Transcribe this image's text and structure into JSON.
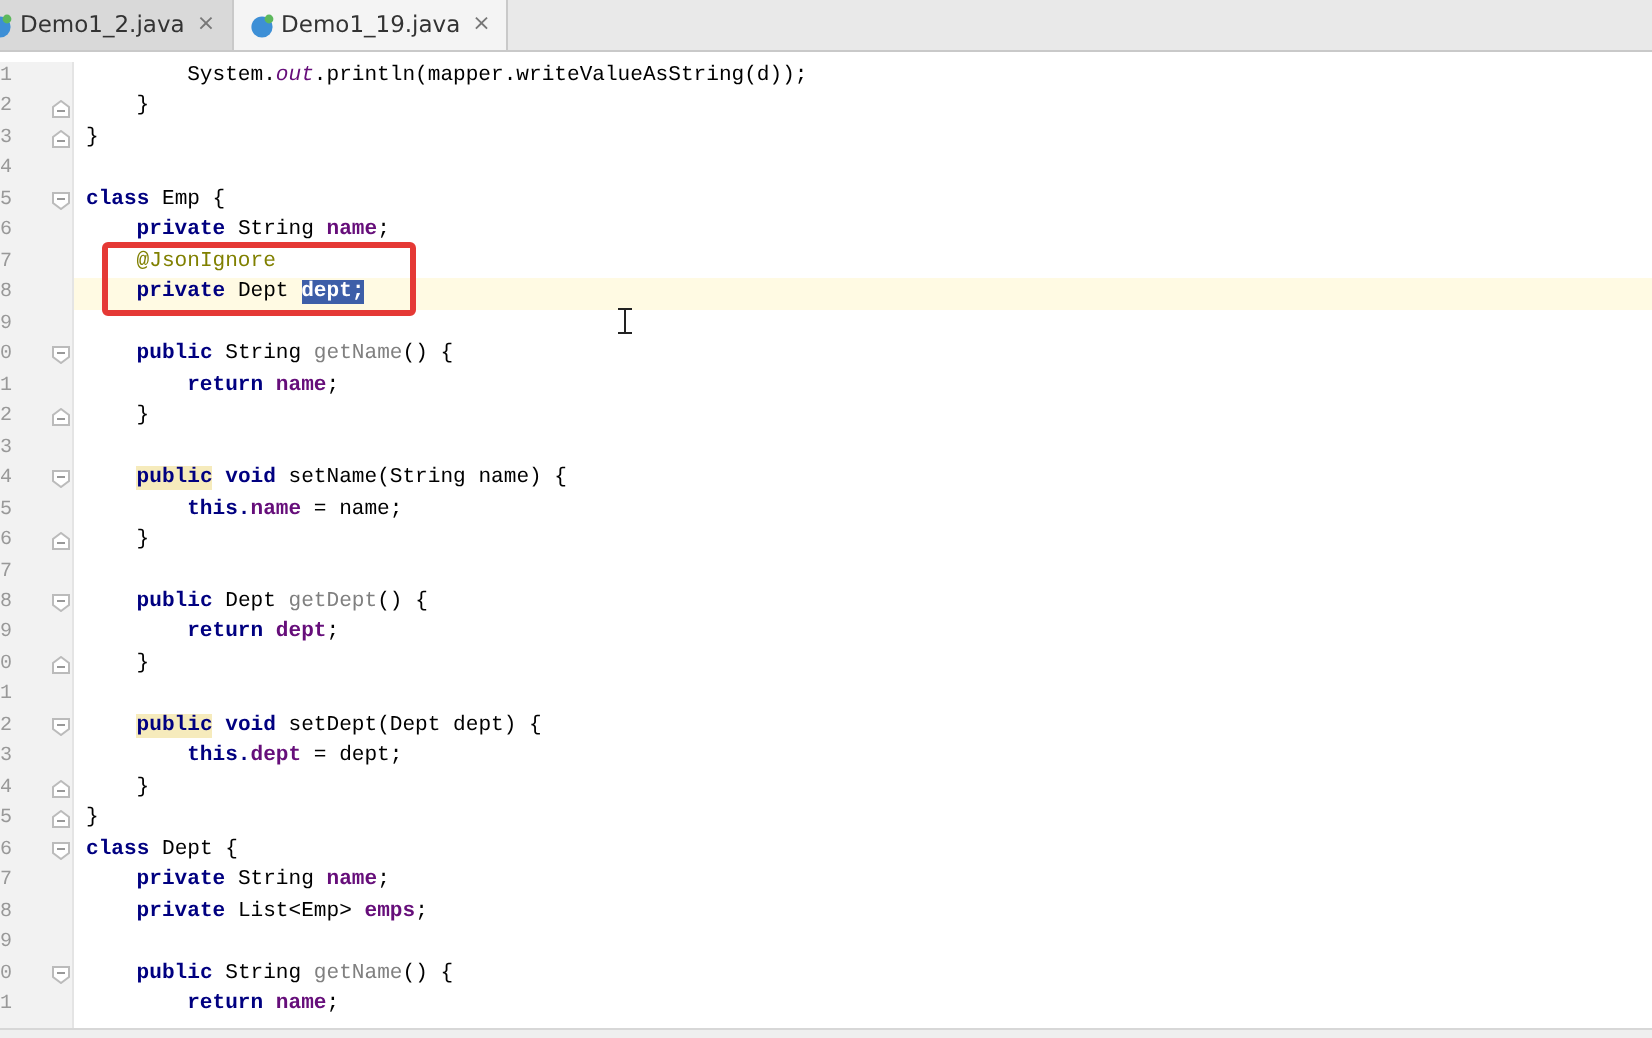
{
  "tabs": [
    {
      "label": "Demo1_2.java",
      "close": "×",
      "selected": false
    },
    {
      "label": "Demo1_19.java",
      "close": "×",
      "selected": true
    }
  ],
  "editor": {
    "lines": [
      {
        "number": "1",
        "kind": "body",
        "current": false,
        "boxed": false,
        "tokens": [
          {
            "kind": "plain",
            "text": "System."
          },
          {
            "kind": "static",
            "text": "out"
          },
          {
            "kind": "plain",
            "text": ".println(mapper.writeValueAsString(d));"
          }
        ]
      },
      {
        "number": "2",
        "kind": "member",
        "fold_marker": {
          "kind": "end"
        },
        "current": false,
        "boxed": false,
        "tokens": [
          {
            "kind": "plain",
            "text": "}"
          }
        ]
      },
      {
        "number": "3",
        "kind": "top",
        "fold_marker": {
          "kind": "end"
        },
        "current": false,
        "boxed": false,
        "tokens": [
          {
            "kind": "plain",
            "text": "}"
          }
        ]
      },
      {
        "number": "4",
        "kind": "top"
      },
      {
        "number": "5",
        "kind": "top",
        "fold_marker": {
          "kind": "start"
        },
        "current": false,
        "boxed": false,
        "tokens": [
          {
            "kind": "kw",
            "text": "class"
          },
          {
            "kind": "plain",
            "text": " Emp {"
          }
        ]
      },
      {
        "number": "6",
        "kind": "member",
        "current": false,
        "boxed": false,
        "tokens": [
          {
            "kind": "kw",
            "text": "private"
          },
          {
            "kind": "plain",
            "text": " String "
          },
          {
            "kind": "field",
            "text": "name"
          },
          {
            "kind": "plain",
            "text": ";"
          }
        ]
      },
      {
        "number": "7",
        "kind": "member",
        "current": false,
        "boxed": true,
        "tokens": [
          {
            "kind": "annotation",
            "text": "@JsonIgnore"
          }
        ]
      },
      {
        "number": "8",
        "kind": "member",
        "current": true,
        "boxed": true,
        "tokens": [
          {
            "kind": "kw",
            "text": "private"
          },
          {
            "kind": "plain",
            "text": " Dept "
          },
          {
            "kind": "field",
            "text": "dept;",
            "selected": true
          }
        ]
      },
      {
        "number": "9",
        "kind": "top"
      },
      {
        "number": "0",
        "kind": "member",
        "fold_marker": {
          "kind": "start"
        },
        "current": false,
        "boxed": false,
        "tokens": [
          {
            "kind": "kw",
            "text": "public"
          },
          {
            "kind": "plain",
            "text": " String "
          },
          {
            "kind": "unused",
            "text": "getName"
          },
          {
            "kind": "plain",
            "text": "() {"
          }
        ]
      },
      {
        "number": "1",
        "kind": "body",
        "current": false,
        "boxed": false,
        "tokens": [
          {
            "kind": "kw",
            "text": "return "
          },
          {
            "kind": "field",
            "text": "name"
          },
          {
            "kind": "plain",
            "text": ";"
          }
        ]
      },
      {
        "number": "2",
        "kind": "member",
        "fold_marker": {
          "kind": "end"
        },
        "current": false,
        "boxed": false,
        "tokens": [
          {
            "kind": "plain",
            "text": "}"
          }
        ]
      },
      {
        "number": "3",
        "kind": "top"
      },
      {
        "number": "4",
        "kind": "member",
        "fold_marker": {
          "kind": "start"
        },
        "current": false,
        "boxed": false,
        "tokens": [
          {
            "kind": "kw",
            "text": "public",
            "usage": true
          },
          {
            "kind": "kw",
            "text": " void"
          },
          {
            "kind": "plain",
            "text": " setName(String name) {"
          }
        ]
      },
      {
        "number": "5",
        "kind": "body",
        "current": false,
        "boxed": false,
        "tokens": [
          {
            "kind": "kw",
            "text": "this."
          },
          {
            "kind": "field",
            "text": "name"
          },
          {
            "kind": "plain",
            "text": " = name;"
          }
        ]
      },
      {
        "number": "6",
        "kind": "member",
        "fold_marker": {
          "kind": "end"
        },
        "current": false,
        "boxed": false,
        "tokens": [
          {
            "kind": "plain",
            "text": "}"
          }
        ]
      },
      {
        "number": "7",
        "kind": "top"
      },
      {
        "number": "8",
        "kind": "member",
        "fold_marker": {
          "kind": "start"
        },
        "current": false,
        "boxed": false,
        "tokens": [
          {
            "kind": "kw",
            "text": "public"
          },
          {
            "kind": "plain",
            "text": " Dept "
          },
          {
            "kind": "unused",
            "text": "getDept"
          },
          {
            "kind": "plain",
            "text": "() {"
          }
        ]
      },
      {
        "number": "9",
        "kind": "body",
        "current": false,
        "boxed": false,
        "tokens": [
          {
            "kind": "kw",
            "text": "return "
          },
          {
            "kind": "field",
            "text": "dept"
          },
          {
            "kind": "plain",
            "text": ";"
          }
        ]
      },
      {
        "number": "0",
        "kind": "member",
        "fold_marker": {
          "kind": "end"
        },
        "current": false,
        "boxed": false,
        "tokens": [
          {
            "kind": "plain",
            "text": "}"
          }
        ]
      },
      {
        "number": "1",
        "kind": "top"
      },
      {
        "number": "2",
        "kind": "member",
        "fold_marker": {
          "kind": "start"
        },
        "current": false,
        "boxed": false,
        "tokens": [
          {
            "kind": "kw",
            "text": "public",
            "usage": true
          },
          {
            "kind": "kw",
            "text": " void"
          },
          {
            "kind": "plain",
            "text": " setDept(Dept dept) {"
          }
        ]
      },
      {
        "number": "3",
        "kind": "body",
        "current": false,
        "boxed": false,
        "tokens": [
          {
            "kind": "kw",
            "text": "this."
          },
          {
            "kind": "field",
            "text": "dept"
          },
          {
            "kind": "plain",
            "text": " = dept;"
          }
        ]
      },
      {
        "number": "4",
        "kind": "member",
        "fold_marker": {
          "kind": "end"
        },
        "current": false,
        "boxed": false,
        "tokens": [
          {
            "kind": "plain",
            "text": "}"
          }
        ]
      },
      {
        "number": "5",
        "kind": "top",
        "fold_marker": {
          "kind": "end"
        },
        "current": false,
        "boxed": false,
        "tokens": [
          {
            "kind": "plain",
            "text": "}"
          }
        ]
      },
      {
        "number": "6",
        "kind": "top",
        "fold_marker": {
          "kind": "start"
        },
        "current": false,
        "boxed": false,
        "tokens": [
          {
            "kind": "kw",
            "text": "class"
          },
          {
            "kind": "plain",
            "text": " Dept {"
          }
        ]
      },
      {
        "number": "7",
        "kind": "member",
        "current": false,
        "boxed": false,
        "tokens": [
          {
            "kind": "kw",
            "text": "private"
          },
          {
            "kind": "plain",
            "text": " String "
          },
          {
            "kind": "field",
            "text": "name"
          },
          {
            "kind": "plain",
            "text": ";"
          }
        ]
      },
      {
        "number": "8",
        "kind": "member",
        "current": false,
        "boxed": false,
        "tokens": [
          {
            "kind": "kw",
            "text": "private"
          },
          {
            "kind": "plain",
            "text": " List<Emp> "
          },
          {
            "kind": "field",
            "text": "emps"
          },
          {
            "kind": "plain",
            "text": ";"
          }
        ]
      },
      {
        "number": "9",
        "kind": "top"
      },
      {
        "number": "0",
        "kind": "member",
        "fold_marker": {
          "kind": "start"
        },
        "current": false,
        "boxed": false,
        "tokens": [
          {
            "kind": "kw",
            "text": "public"
          },
          {
            "kind": "plain",
            "text": " String "
          },
          {
            "kind": "unused",
            "text": "getName"
          },
          {
            "kind": "plain",
            "text": "() {"
          }
        ]
      },
      {
        "number": "1",
        "kind": "body",
        "current": false,
        "boxed": false,
        "tokens": [
          {
            "kind": "kw",
            "text": "return "
          },
          {
            "kind": "field",
            "text": "name"
          },
          {
            "kind": "plain",
            "text": ";"
          }
        ]
      }
    ]
  }
}
